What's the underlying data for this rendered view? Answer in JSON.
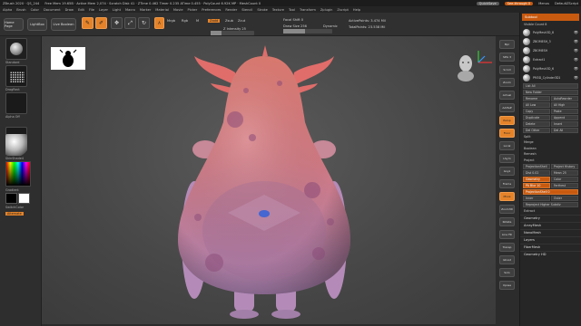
{
  "titlebar": {
    "app": "ZBrush 2020 · QS_244",
    "status": "Free Mem 19.65B · Active Mem 2,074 · Scratch Disk 41 · ZTime 0.462 Timer 0.235 ATime 0.455 · PolyCount 6.92K MP · MeshCount 0",
    "quicksave": "QuickSave",
    "seethrough": "See-through 0",
    "menus_label": "Menus",
    "script": "DefaultZScript"
  },
  "menubar": [
    "Alpha",
    "Brush",
    "Color",
    "Document",
    "Draw",
    "Edit",
    "File",
    "Layer",
    "Light",
    "Macro",
    "Marker",
    "Material",
    "Movie",
    "Picker",
    "Preferences",
    "Render",
    "Stencil",
    "Stroke",
    "Texture",
    "Tool",
    "Transform",
    "Zplugin",
    "Zscript",
    "Help"
  ],
  "toolbar": {
    "home_page": "Home Page",
    "lightbox": "LightBox",
    "live_boolean": "Live Boolean",
    "edit": "Edit",
    "draw": "Draw",
    "move": "Move",
    "scale": "Scale",
    "rotate": "Rotate",
    "a_label": "A",
    "mrgb": "Mrgb",
    "rgb": "Rgb",
    "m_label": "M",
    "zadd": "Zadd",
    "zsub": "Zsub",
    "zcut": "Zcut",
    "focal_shift": "Focal Shift 0",
    "draw_size": "Draw Size 256",
    "z_intensity": "Z Intensity 25",
    "dynamic": "Dynamic",
    "active_points": "ActivePoints: 3.474 Mil",
    "total_points": "TotalPoints: 23.538 Mil"
  },
  "left_panel": {
    "standard": "Standard",
    "dots": "DragRect",
    "alpha_off": "Alpha Off",
    "texture_off": "Texture Off",
    "matcap": "SkinShade4",
    "gradient": "Gradient",
    "switch_color": "SwitchColor",
    "alternate": "Alternate"
  },
  "right_shelf": [
    "Bpr",
    "SPix 3",
    "Scroll",
    "Zoom",
    "Actual",
    "AAHalf",
    "Persp",
    "Floor",
    "Local",
    "LSym",
    "Gxyz",
    "Frame",
    "Move",
    "Zoom3D",
    "Rotate",
    "Line Fill",
    "Transp",
    "Ghost",
    "Solo",
    "Xpose"
  ],
  "tray": {
    "subtool_label": "Subtool",
    "visible_count": "Visible Count 8",
    "subtools": [
      "PolyMesh3D_8",
      "ZBOMESH_3",
      "ZBOMESH",
      "Extract1",
      "PolyMesh3D_6",
      "PM3D_Cylinder3D1"
    ],
    "list_all": "List All",
    "new_folder": "New Folder",
    "rename": "Rename",
    "auto_reorder": "AutoReorder",
    "all_low": "All Low",
    "all_high": "All High",
    "copy": "Copy",
    "paste": "Paste",
    "append": "Append",
    "duplicate": "Duplicate",
    "insert": "Insert",
    "delete": "Delete",
    "del_other": "Del Other",
    "del_all": "Del All",
    "split": "Split",
    "merge": "Merge",
    "boolean": "Boolean",
    "remesh": "Remesh",
    "project": "Project",
    "project_bas_relief": "ProjectionShell",
    "project_history": "Project History",
    "dist": "Dist 0.02",
    "mean": "Mean 25",
    "geometry_label": "Geometry",
    "colorize": "Color",
    "fit_bur": "PA Blur 10",
    "farthest": "Farthest",
    "projection_shell": "ProjectionShell 0",
    "inner": "Inner",
    "outer": "Outer",
    "reproject": "Reproject Higher Subdiv",
    "extract": "Extract",
    "sections": [
      "Geometry",
      "ArrayMesh",
      "NanoMesh",
      "Layers",
      "FiberMesh",
      "Geometry HD"
    ]
  },
  "colors": {
    "accent": "#e4832a",
    "accent_dark": "#c85a10",
    "bg": "#2b2b2b",
    "creature_top": "#e07a70",
    "creature_bottom": "#a77fae",
    "spot": "#8a4a78"
  }
}
